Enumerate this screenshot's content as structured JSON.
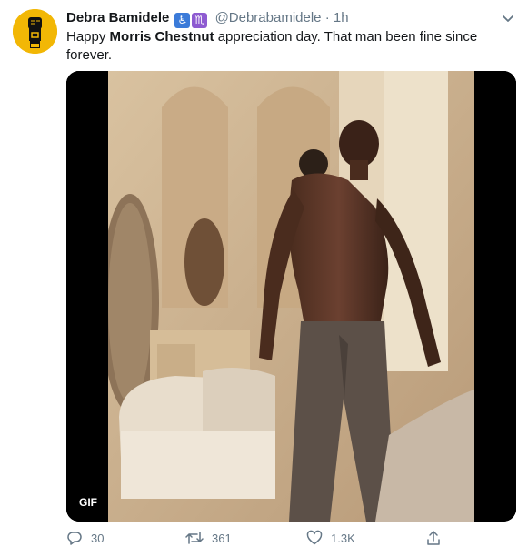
{
  "tweet": {
    "author_name": "Debra Bamidele",
    "emoji_1": "♿",
    "emoji_2": "♏",
    "handle": "@Debrabamidele",
    "separator": "·",
    "time": "1h",
    "text_before": "Happy ",
    "text_bold": "Morris Chestnut",
    "text_after": " appreciation day. That man been fine since forever.",
    "media_badge": "GIF",
    "replies": "30",
    "retweets": "361",
    "likes": "1.3K"
  },
  "colors": {
    "avatar_bg": "#f2b705",
    "text_primary": "#14171a",
    "text_secondary": "#657786"
  },
  "icons": {
    "reply": "reply-icon",
    "retweet": "retweet-icon",
    "like": "heart-icon",
    "share": "share-icon",
    "caret": "chevron-down-icon"
  }
}
